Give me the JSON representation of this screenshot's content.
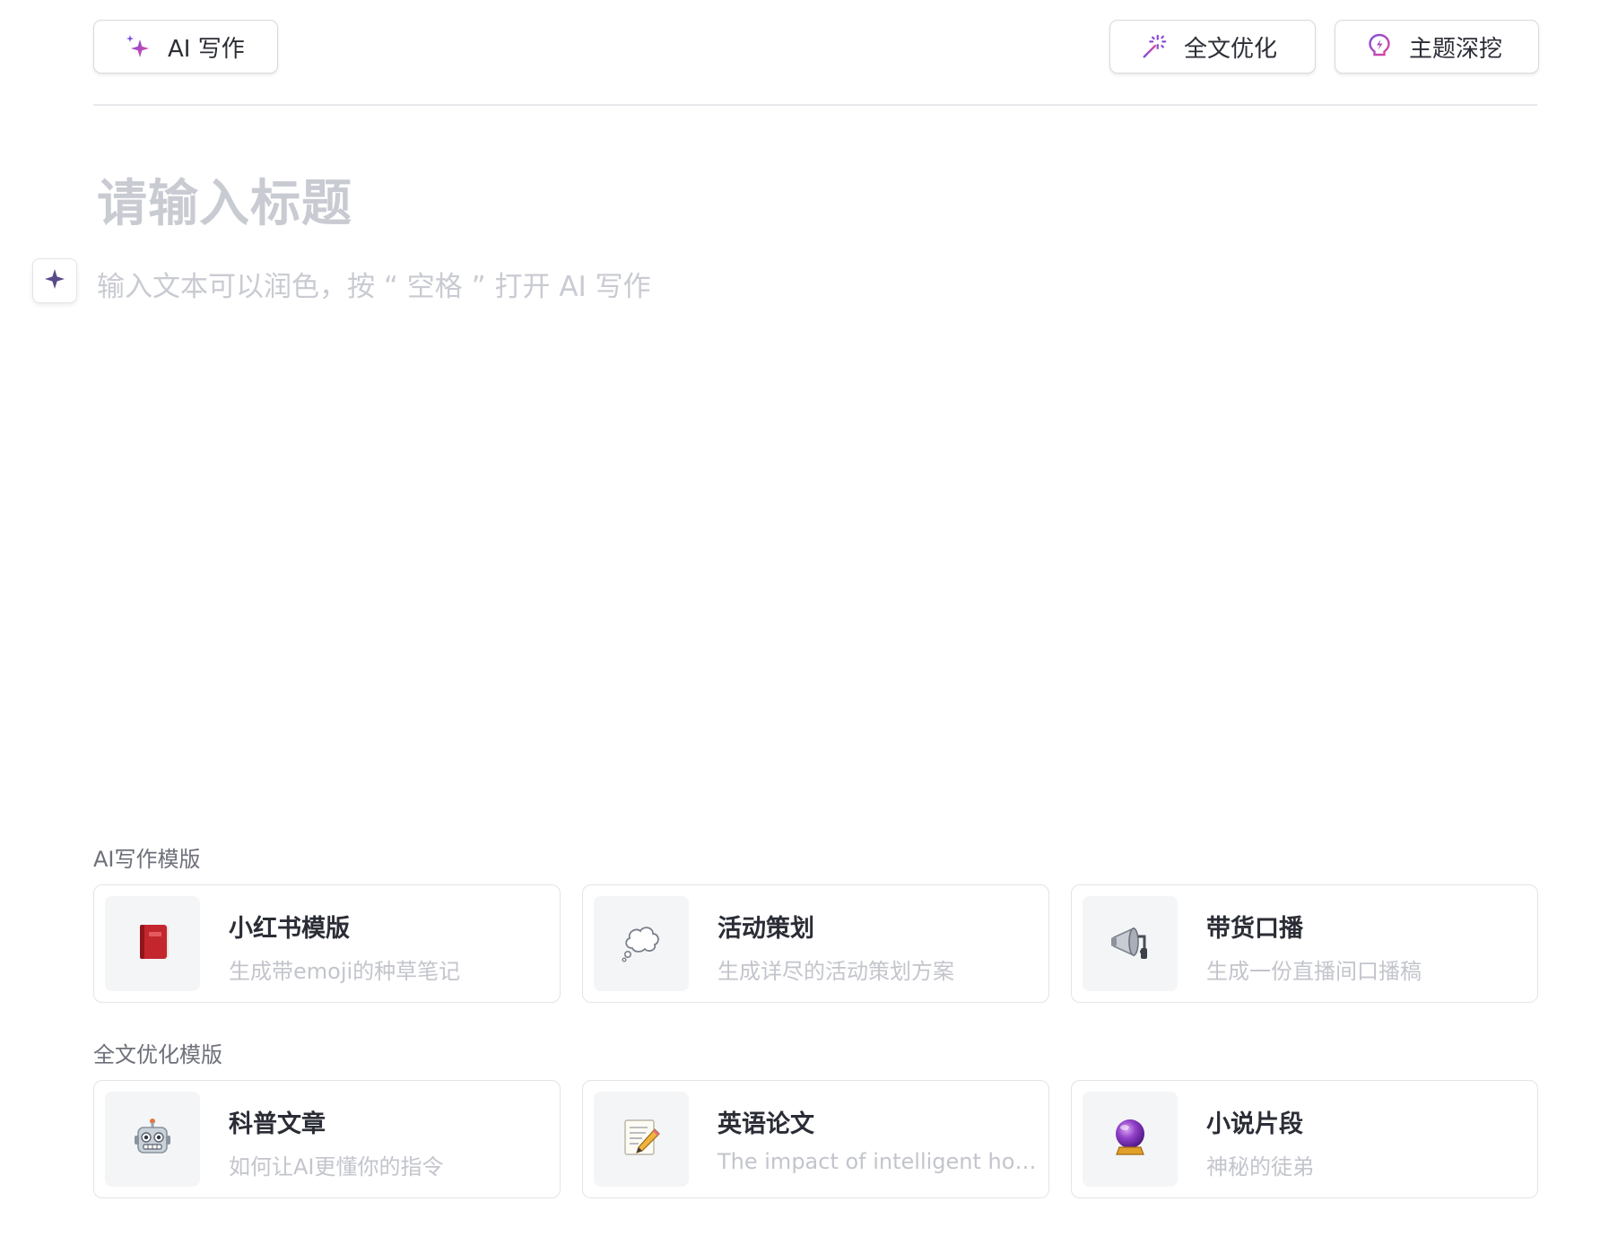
{
  "toolbar": {
    "ai_write_label": "AI 写作",
    "optimize_label": "全文优化",
    "topic_label": "主题深挖"
  },
  "editor": {
    "title_placeholder": "请输入标题",
    "body_placeholder": "输入文本可以润色，按 “ 空格 ” 打开 AI 写作"
  },
  "templates": {
    "ai_section_label": "AI写作模版",
    "ai_items": [
      {
        "title": "小红书模版",
        "desc": "生成带emoji的种草笔记",
        "icon": "red-book-icon"
      },
      {
        "title": "活动策划",
        "desc": "生成详尽的活动策划方案",
        "icon": "thought-bubble-icon"
      },
      {
        "title": "带货口播",
        "desc": "生成一份直播间口播稿",
        "icon": "megaphone-icon"
      }
    ],
    "optimize_section_label": "全文优化模版",
    "optimize_items": [
      {
        "title": "科普文章",
        "desc": "如何让AI更懂你的指令",
        "icon": "robot-icon"
      },
      {
        "title": "英语论文",
        "desc": "The impact of intelligent hou...",
        "icon": "memo-pencil-icon"
      },
      {
        "title": "小说片段",
        "desc": "神秘的徒弟",
        "icon": "crystal-ball-icon"
      }
    ]
  },
  "colors": {
    "accent_purple": "#8a4bd6",
    "accent_pink": "#e0469a",
    "placeholder_gray": "#c9cbd2",
    "border_gray": "#e3e4e8"
  }
}
